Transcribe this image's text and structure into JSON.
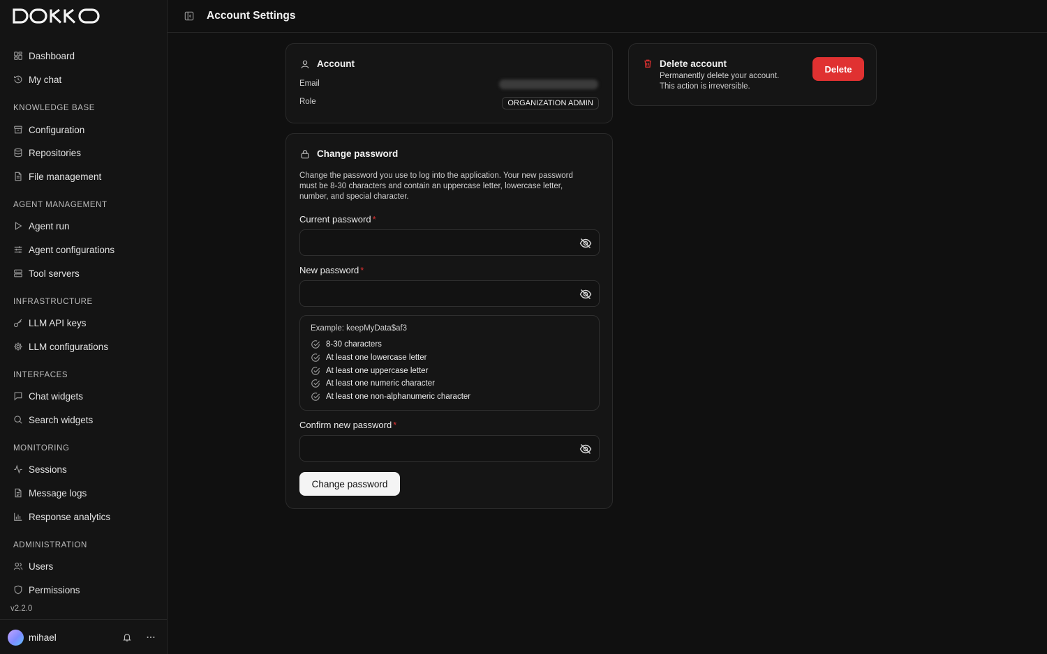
{
  "brand": {
    "logo_text": "DOKKO"
  },
  "sidebar": {
    "top_items": [
      {
        "label": "Dashboard",
        "icon": "dashboard-icon"
      },
      {
        "label": "My chat",
        "icon": "history-icon"
      }
    ],
    "sections": [
      {
        "title": "KNOWLEDGE BASE",
        "items": [
          {
            "label": "Configuration",
            "icon": "archive-icon"
          },
          {
            "label": "Repositories",
            "icon": "database-icon"
          },
          {
            "label": "File management",
            "icon": "file-icon"
          }
        ]
      },
      {
        "title": "AGENT MANAGEMENT",
        "items": [
          {
            "label": "Agent run",
            "icon": "play-icon"
          },
          {
            "label": "Agent configurations",
            "icon": "sliders-icon"
          },
          {
            "label": "Tool servers",
            "icon": "server-icon"
          }
        ]
      },
      {
        "title": "INFRASTRUCTURE",
        "items": [
          {
            "label": "LLM API keys",
            "icon": "key-icon"
          },
          {
            "label": "LLM configurations",
            "icon": "gear-icon"
          }
        ]
      },
      {
        "title": "INTERFACES",
        "items": [
          {
            "label": "Chat widgets",
            "icon": "message-icon"
          },
          {
            "label": "Search widgets",
            "icon": "search-icon"
          }
        ]
      },
      {
        "title": "MONITORING",
        "items": [
          {
            "label": "Sessions",
            "icon": "activity-icon"
          },
          {
            "label": "Message logs",
            "icon": "file-text-icon"
          },
          {
            "label": "Response analytics",
            "icon": "bar-chart-icon"
          }
        ]
      },
      {
        "title": "ADMINISTRATION",
        "items": [
          {
            "label": "Users",
            "icon": "users-icon"
          },
          {
            "label": "Permissions",
            "icon": "shield-icon"
          }
        ]
      }
    ],
    "version": "v2.2.0",
    "user": {
      "name": "mihael"
    }
  },
  "header": {
    "title": "Account Settings"
  },
  "account": {
    "title": "Account",
    "email_label": "Email",
    "role_label": "Role",
    "role_value": "ORGANIZATION ADMIN"
  },
  "delete_account": {
    "title": "Delete account",
    "desc_line1": "Permanently delete your account.",
    "desc_line2": "This action is irreversible.",
    "button_label": "Delete",
    "accent": "#e03131"
  },
  "change_password": {
    "title": "Change password",
    "description": "Change the password you use to log into the application. Your new password must be 8-30 characters and contain an uppercase letter, lowercase letter, number, and special character.",
    "current_label": "Current password",
    "new_label": "New password",
    "confirm_label": "Confirm new password",
    "required_mark": "*",
    "current_value": "",
    "new_value": "",
    "confirm_value": "",
    "example": "Example: keepMyData$af3",
    "requirements": [
      "8-30 characters",
      "At least one lowercase letter",
      "At least one uppercase letter",
      "At least one numeric character",
      "At least one non-alphanumeric character"
    ],
    "button_label": "Change password"
  }
}
